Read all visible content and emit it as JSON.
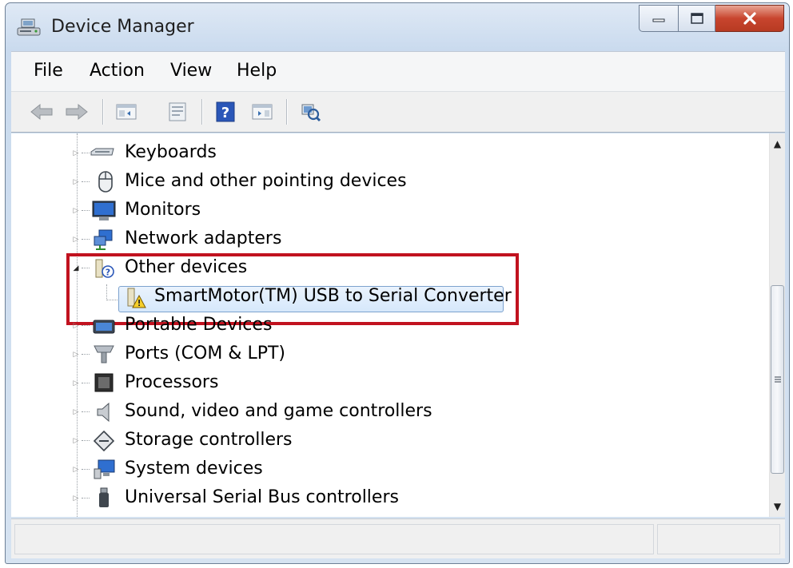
{
  "window": {
    "title": "Device Manager",
    "icon": "device-manager-icon",
    "controls": [
      "minimize-icon",
      "maximize-icon",
      "close-icon"
    ]
  },
  "menu": {
    "items": [
      {
        "label": "File"
      },
      {
        "label": "Action"
      },
      {
        "label": "View"
      },
      {
        "label": "Help"
      }
    ]
  },
  "toolbar": {
    "buttons": [
      "back-arrow-icon",
      "forward-arrow-icon",
      "show-hide-console-tree-icon",
      "properties-icon",
      "help-icon",
      "show-action-pane-icon",
      "scan-hardware-changes-icon"
    ]
  },
  "tree": {
    "nodes": [
      {
        "label": "Keyboards",
        "icon": "keyboard-icon",
        "expanded": false
      },
      {
        "label": "Mice and other pointing devices",
        "icon": "mouse-icon",
        "expanded": false
      },
      {
        "label": "Monitors",
        "icon": "monitor-icon",
        "expanded": false
      },
      {
        "label": "Network adapters",
        "icon": "network-adapter-icon",
        "expanded": false
      },
      {
        "label": "Other devices",
        "icon": "unknown-device-icon",
        "expanded": true
      },
      {
        "label": "SmartMotor(TM) USB to Serial Converter",
        "icon": "warning-device-icon",
        "selected": true
      },
      {
        "label": "Portable Devices",
        "icon": "portable-device-icon",
        "expanded": false
      },
      {
        "label": "Ports (COM & LPT)",
        "icon": "port-icon",
        "expanded": false
      },
      {
        "label": "Processors",
        "icon": "processor-icon",
        "expanded": false
      },
      {
        "label": "Sound, video and game controllers",
        "icon": "speaker-icon",
        "expanded": false
      },
      {
        "label": "Storage controllers",
        "icon": "storage-controller-icon",
        "expanded": false
      },
      {
        "label": "System devices",
        "icon": "system-device-icon",
        "expanded": false
      },
      {
        "label": "Universal Serial Bus controllers",
        "icon": "usb-icon",
        "expanded": false
      }
    ]
  },
  "colors": {
    "highlight_border": "#c1121f",
    "selection_fill": "#d6e8fb",
    "selection_border": "#7da2ce"
  }
}
